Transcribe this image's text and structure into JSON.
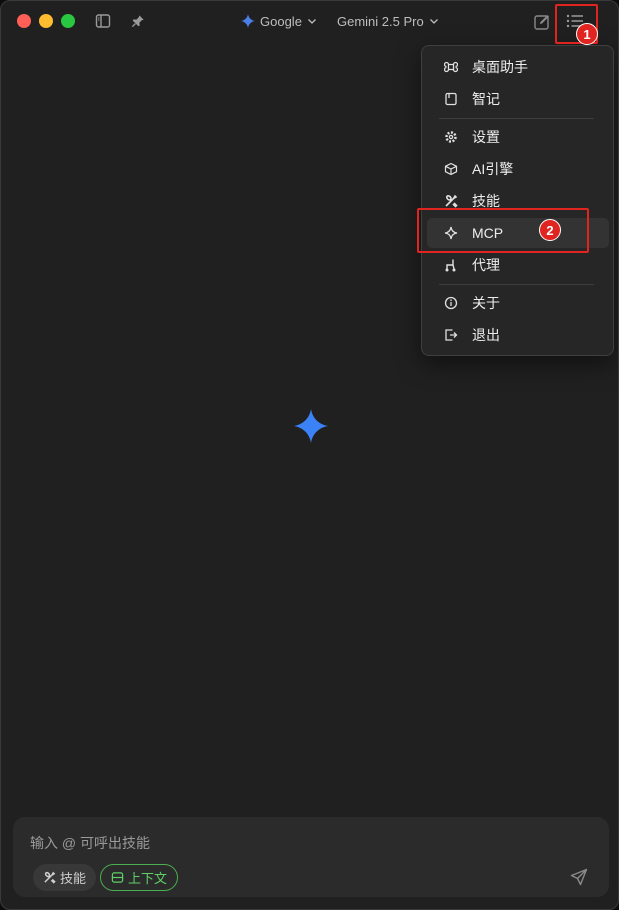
{
  "titlebar": {
    "provider": "Google",
    "model": "Gemini 2.5 Pro"
  },
  "annotations": {
    "badge1": "1",
    "badge2": "2",
    "highlight_color": "#e0241f"
  },
  "menu": {
    "items": [
      {
        "label": "桌面助手",
        "icon": "command-icon"
      },
      {
        "label": "智记",
        "icon": "notebook-icon"
      },
      {
        "label": "设置",
        "icon": "gear-icon"
      },
      {
        "label": "AI引擎",
        "icon": "cube-icon"
      },
      {
        "label": "技能",
        "icon": "tools-icon"
      },
      {
        "label": "MCP",
        "icon": "sparkle-icon",
        "active": true
      },
      {
        "label": "代理",
        "icon": "proxy-icon"
      },
      {
        "label": "关于",
        "icon": "info-icon"
      },
      {
        "label": "退出",
        "icon": "logout-icon"
      }
    ]
  },
  "composer": {
    "placeholder": "输入 @ 可呼出技能",
    "skill_chip": "技能",
    "context_chip": "上下文"
  },
  "colors": {
    "accent_blue": "#3b82f6",
    "context_green": "#4caf50",
    "background": "#202020",
    "menu_bg": "#262626"
  }
}
